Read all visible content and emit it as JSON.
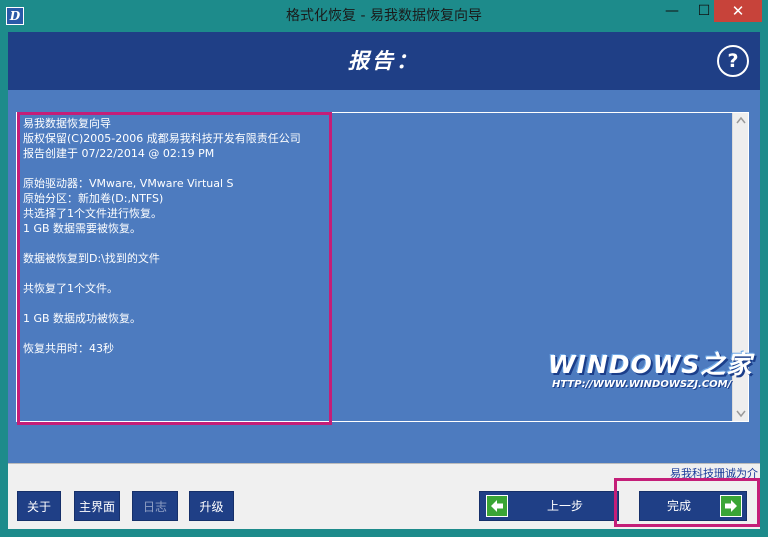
{
  "window": {
    "title": "格式化恢复 - 易我数据恢复向导",
    "minimize_glyph": "—",
    "maximize_glyph": "☐",
    "close_glyph": "✕",
    "app_icon_letter": "D"
  },
  "header": {
    "title": "报告：",
    "help_glyph": "?"
  },
  "report": {
    "text": "易我数据恢复向导\n版权保留(C)2005-2006 成都易我科技开发有限责任公司\n报告创建于 07/22/2014 @ 02:19 PM\n\n原始驱动器：VMware, VMware Virtual S\n原始分区：新加卷(D:,NTFS)\n共选择了1个文件进行恢复。\n1 GB 数据需要被恢复。\n\n数据被恢复到D:\\找到的文件\n\n共恢复了1个文件。\n\n1 GB 数据成功被恢复。\n\n恢复共用时：43秒"
  },
  "watermark": {
    "main": "WINDOWS之家",
    "url": "HTTP://WWW.WINDOWSZJ.COM/"
  },
  "footer": {
    "brand_link": "易我科技珊诚为介",
    "about_label": "关于",
    "home_label": "主界面",
    "log_label": "日志",
    "upgrade_label": "升级",
    "prev_label": "上一步",
    "finish_label": "完成"
  },
  "colors": {
    "titlebar": "#1d8b8b",
    "header_band": "#1f3f86",
    "main_panel": "#4d7bbf",
    "button": "#1f3f86",
    "arrow_green": "#3aa535",
    "highlight": "#c41e78"
  },
  "icons": {
    "scroll_up": "triangle-up-icon",
    "scroll_down": "triangle-down-icon",
    "prev": "arrow-left-icon",
    "finish": "arrow-right-icon"
  }
}
